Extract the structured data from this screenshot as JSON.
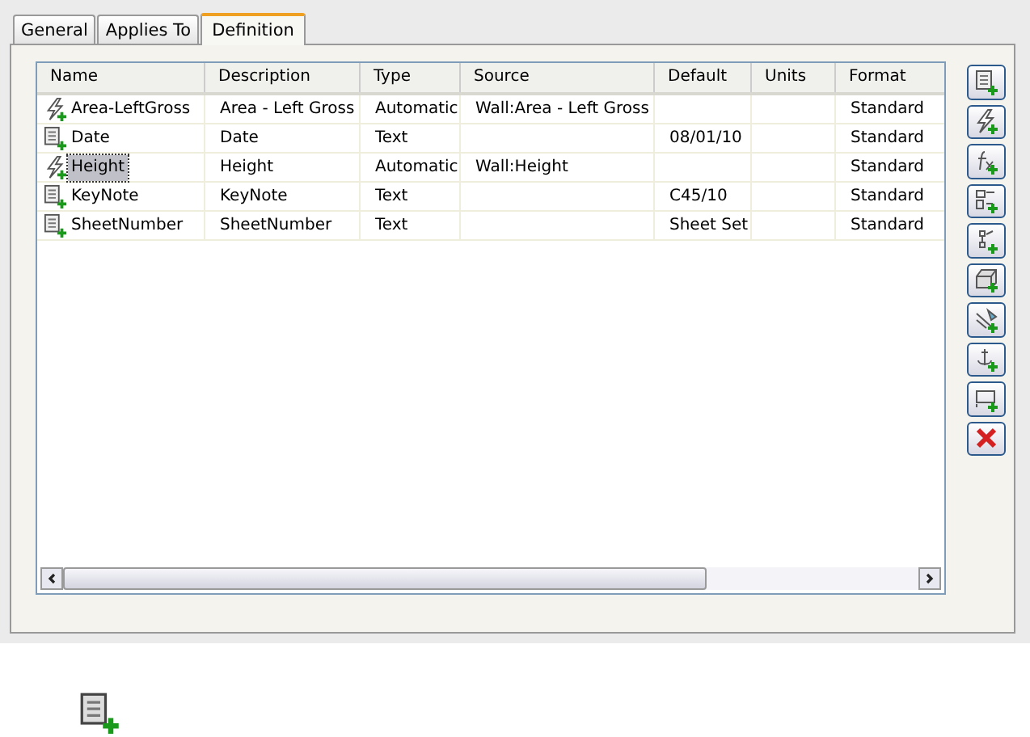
{
  "tabs": [
    {
      "label": "General",
      "selected": false
    },
    {
      "label": "Applies To",
      "selected": false
    },
    {
      "label": "Definition",
      "selected": true
    }
  ],
  "table": {
    "columns": [
      "Name",
      "Description",
      "Type",
      "Source",
      "Default",
      "Units",
      "Format"
    ],
    "rows": [
      {
        "kind": "automatic",
        "selected": false,
        "cells": [
          "Area-LeftGross",
          "Area - Left Gross",
          "Automatic",
          "Wall:Area - Left Gross",
          "",
          "",
          "Standard"
        ]
      },
      {
        "kind": "text",
        "selected": false,
        "cells": [
          "Date",
          "Date",
          "Text",
          "",
          "08/01/10",
          "",
          "Standard"
        ]
      },
      {
        "kind": "automatic",
        "selected": true,
        "cells": [
          "Height",
          "Height",
          "Automatic",
          "Wall:Height",
          "",
          "",
          "Standard"
        ]
      },
      {
        "kind": "text",
        "selected": false,
        "cells": [
          "KeyNote",
          "KeyNote",
          "Text",
          "",
          "C45/10",
          "",
          "Standard"
        ]
      },
      {
        "kind": "text",
        "selected": false,
        "cells": [
          "SheetNumber",
          "SheetNumber",
          "Text",
          "",
          "Sheet Set",
          "",
          "Standard"
        ]
      }
    ]
  },
  "toolbar": [
    {
      "kind": "text"
    },
    {
      "kind": "automatic"
    },
    {
      "kind": "formula"
    },
    {
      "kind": "graphic"
    },
    {
      "kind": "classification"
    },
    {
      "kind": "material"
    },
    {
      "kind": "anchor"
    },
    {
      "kind": "anchor-text"
    },
    {
      "kind": "location"
    },
    {
      "kind": "delete"
    }
  ],
  "footer_icon": {
    "kind": "text"
  }
}
